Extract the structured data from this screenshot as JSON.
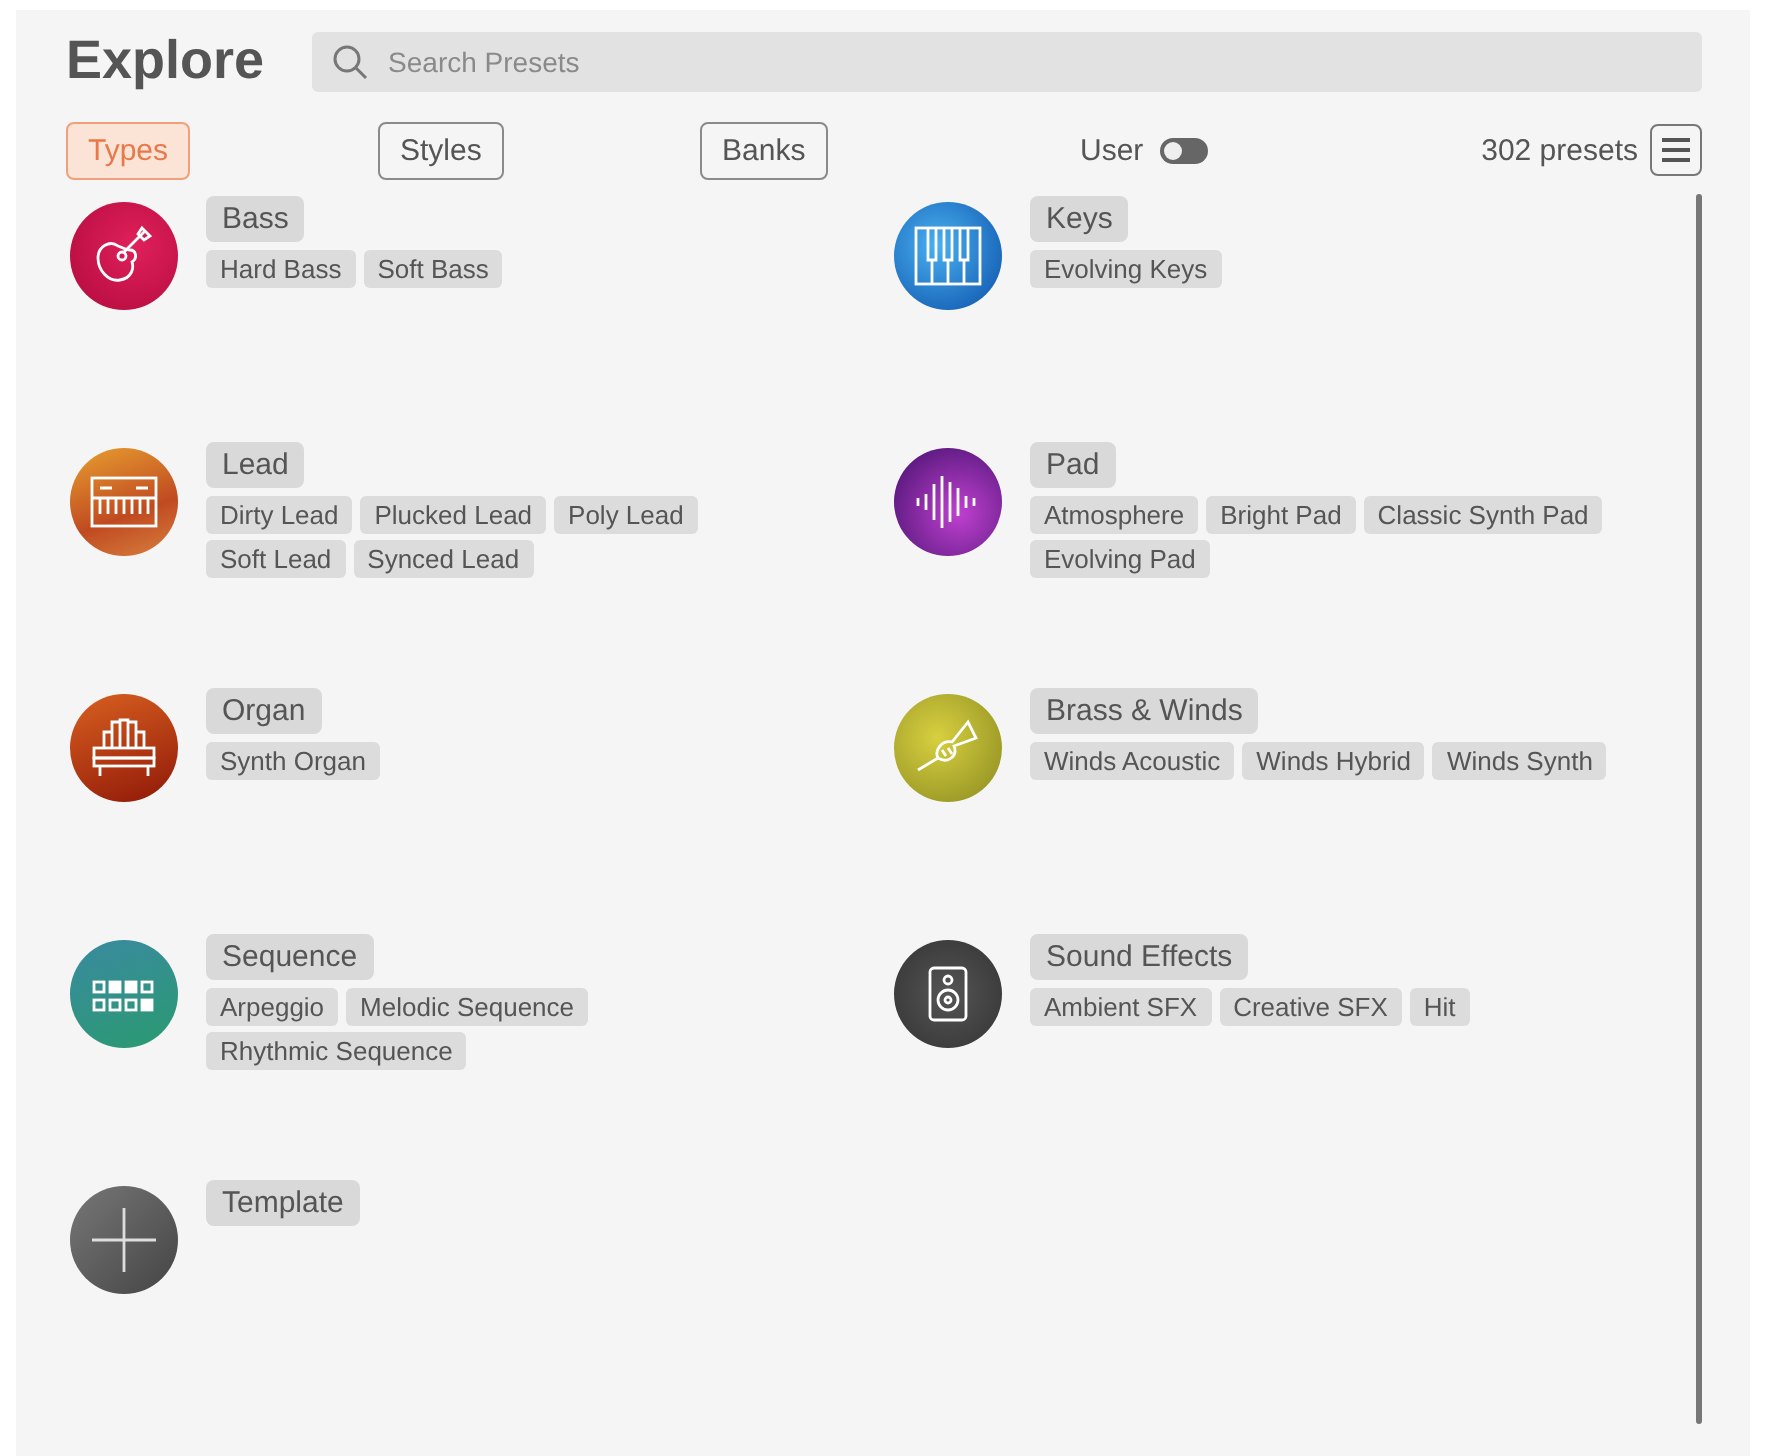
{
  "title": "Explore",
  "search": {
    "placeholder": "Search Presets"
  },
  "tabs": [
    {
      "label": "Types",
      "selected": true
    },
    {
      "label": "Styles",
      "selected": false
    },
    {
      "label": "Banks",
      "selected": false
    }
  ],
  "user_toggle": {
    "label": "User",
    "on": false
  },
  "count": "302 presets",
  "categories": [
    {
      "kind": "bass",
      "name": "Bass",
      "tags": [
        "Hard Bass",
        "Soft Bass"
      ]
    },
    {
      "kind": "keys",
      "name": "Keys",
      "tags": [
        "Evolving Keys"
      ]
    },
    {
      "kind": "lead",
      "name": "Lead",
      "tags": [
        "Dirty Lead",
        "Plucked Lead",
        "Poly Lead",
        "Soft Lead",
        "Synced Lead"
      ]
    },
    {
      "kind": "pad",
      "name": "Pad",
      "tags": [
        "Atmosphere",
        "Bright Pad",
        "Classic Synth Pad",
        "Evolving Pad"
      ]
    },
    {
      "kind": "organ",
      "name": "Organ",
      "tags": [
        "Synth Organ"
      ]
    },
    {
      "kind": "brass",
      "name": "Brass & Winds",
      "tags": [
        "Winds Acoustic",
        "Winds Hybrid",
        "Winds Synth"
      ]
    },
    {
      "kind": "sequence",
      "name": "Sequence",
      "tags": [
        "Arpeggio",
        "Melodic Sequence",
        "Rhythmic Sequence"
      ]
    },
    {
      "kind": "sfx",
      "name": "Sound Effects",
      "tags": [
        "Ambient SFX",
        "Creative SFX",
        "Hit"
      ]
    },
    {
      "kind": "template",
      "name": "Template"
    }
  ]
}
